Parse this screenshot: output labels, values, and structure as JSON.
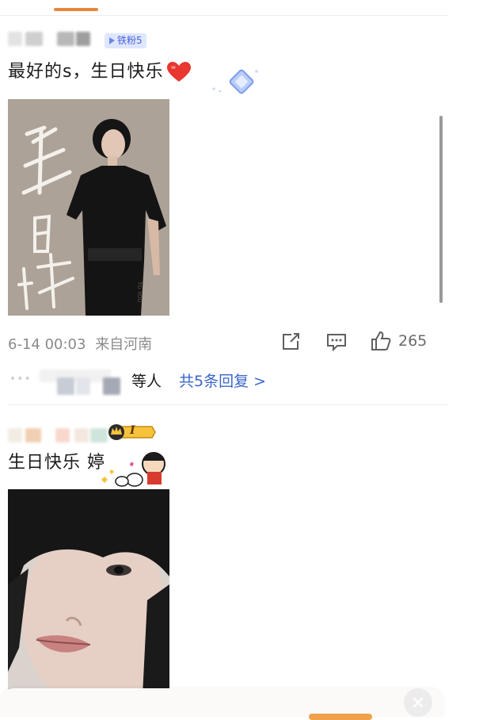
{
  "comments": [
    {
      "badge": "铁粉5",
      "text": "最好的s，生日快乐",
      "emoji": "heart-emoji",
      "date": "6-14 00:03",
      "location": "来自河南",
      "likes": "265",
      "poster_caption_chars": [
        "生",
        "日",
        "快"
      ],
      "poster_credit": "TO YOU",
      "reply_prefix": "等人",
      "reply_link": "共5条回复 >"
    },
    {
      "badge": "I",
      "text": "生日快乐 婷",
      "sticker": "crayon-shin-chan-sticker"
    }
  ],
  "colors": {
    "accent": "#e8873a",
    "link": "#3a66c9",
    "meta": "#8a8a8a",
    "fan_badge_bg": "#dfe7ff",
    "fan_badge_fg": "#4a63d8",
    "poster_bg": "#a99f94"
  }
}
